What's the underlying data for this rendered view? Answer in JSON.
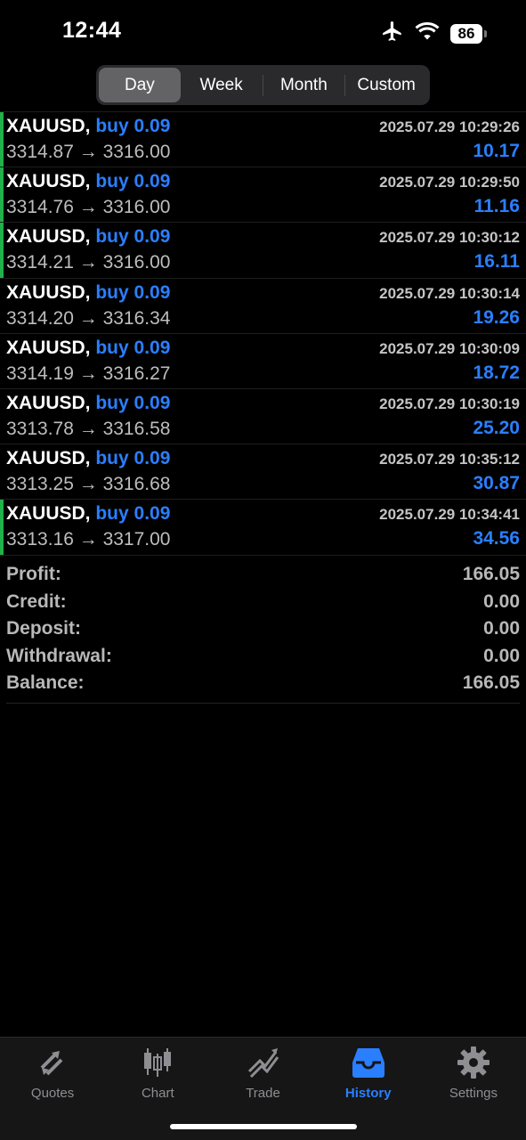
{
  "status_bar": {
    "time": "12:44",
    "battery": "86"
  },
  "periods": [
    {
      "label": "Day",
      "active": true
    },
    {
      "label": "Week",
      "active": false
    },
    {
      "label": "Month",
      "active": false
    },
    {
      "label": "Custom",
      "active": false
    }
  ],
  "trades": [
    {
      "symbol": "XAUUSD,",
      "side": "buy 0.09",
      "time": "2025.07.29 10:29:26",
      "prices": "3314.87 → 3316.00",
      "profit": "10.17",
      "marked": true
    },
    {
      "symbol": "XAUUSD,",
      "side": "buy 0.09",
      "time": "2025.07.29 10:29:50",
      "prices": "3314.76 → 3316.00",
      "profit": "11.16",
      "marked": true
    },
    {
      "symbol": "XAUUSD,",
      "side": "buy 0.09",
      "time": "2025.07.29 10:30:12",
      "prices": "3314.21 → 3316.00",
      "profit": "16.11",
      "marked": true
    },
    {
      "symbol": "XAUUSD,",
      "side": "buy 0.09",
      "time": "2025.07.29 10:30:14",
      "prices": "3314.20 → 3316.34",
      "profit": "19.26",
      "marked": false
    },
    {
      "symbol": "XAUUSD,",
      "side": "buy 0.09",
      "time": "2025.07.29 10:30:09",
      "prices": "3314.19 → 3316.27",
      "profit": "18.72",
      "marked": false
    },
    {
      "symbol": "XAUUSD,",
      "side": "buy 0.09",
      "time": "2025.07.29 10:30:19",
      "prices": "3313.78 → 3316.58",
      "profit": "25.20",
      "marked": false
    },
    {
      "symbol": "XAUUSD,",
      "side": "buy 0.09",
      "time": "2025.07.29 10:35:12",
      "prices": "3313.25 → 3316.68",
      "profit": "30.87",
      "marked": false
    },
    {
      "symbol": "XAUUSD,",
      "side": "buy 0.09",
      "time": "2025.07.29 10:34:41",
      "prices": "3313.16 → 3317.00",
      "profit": "34.56",
      "marked": true
    }
  ],
  "summary": [
    {
      "label": "Profit:",
      "value": "166.05"
    },
    {
      "label": "Credit:",
      "value": "0.00"
    },
    {
      "label": "Deposit:",
      "value": "0.00"
    },
    {
      "label": "Withdrawal:",
      "value": "0.00"
    },
    {
      "label": "Balance:",
      "value": "166.05"
    }
  ],
  "tabs": [
    {
      "label": "Quotes",
      "icon": "quotes-icon",
      "active": false
    },
    {
      "label": "Chart",
      "icon": "candlestick-icon",
      "active": false
    },
    {
      "label": "Trade",
      "icon": "trade-icon",
      "active": false
    },
    {
      "label": "History",
      "icon": "inbox-icon",
      "active": true
    },
    {
      "label": "Settings",
      "icon": "gear-icon",
      "active": false
    }
  ],
  "colors": {
    "accent": "#2a7fff",
    "marker": "#22b04a",
    "background": "#000000"
  }
}
